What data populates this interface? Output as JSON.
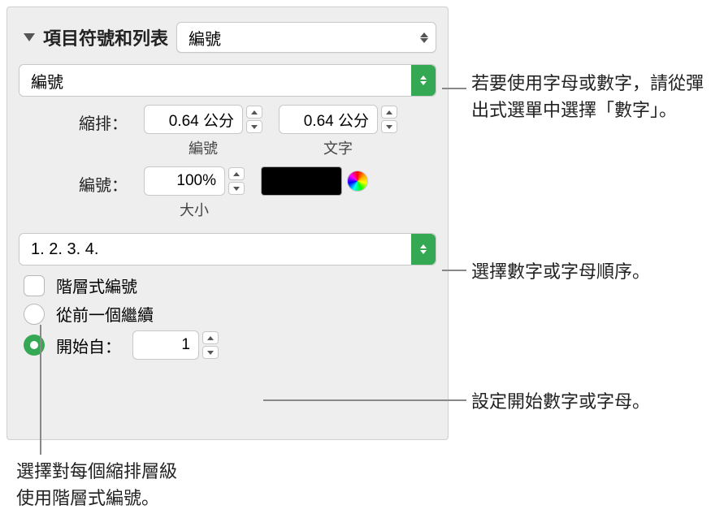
{
  "header": {
    "title": "項目符號和列表",
    "type_dropdown": "編號"
  },
  "style_dropdown": "編號",
  "indent": {
    "label": "縮排：",
    "number_value": "0.64 公分",
    "number_sublabel": "編號",
    "text_value": "0.64 公分",
    "text_sublabel": "文字"
  },
  "size_row": {
    "label": "編號：",
    "size_value": "100%",
    "size_sublabel": "大小"
  },
  "sequence_dropdown": "1. 2. 3. 4.",
  "hierarchical": {
    "label": "階層式編號"
  },
  "continue_radio": {
    "label": "從前一個繼續"
  },
  "startfrom_radio": {
    "label": "開始自：",
    "value": "1"
  },
  "annotations": {
    "type_note": "若要使用字母或數字，請從彈出式選單中選擇「數字」。",
    "sequence_note": "選擇數字或字母順序。",
    "startfrom_note": "設定開始數字或字母。",
    "hierarchical_note_line1": "選擇對每個縮排層級",
    "hierarchical_note_line2": "使用階層式編號。"
  }
}
